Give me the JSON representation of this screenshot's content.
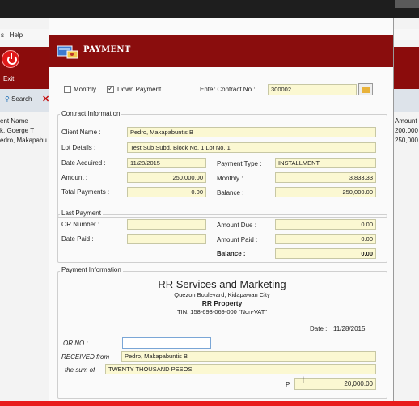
{
  "background_app": {
    "menu_help": "Help",
    "menu_prefix": "s",
    "exit_label": "Exit",
    "search_label": "Search",
    "left_table": {
      "header": "ent Name",
      "rows": [
        "k, Goerge T",
        "edro, Makapabu"
      ]
    },
    "right_table": {
      "header": "Amount",
      "rows": [
        "200,000",
        "250,000"
      ]
    }
  },
  "dialog": {
    "title": "PAYMENT",
    "top_options": {
      "monthly_label": "Monthly",
      "monthly_checked": false,
      "down_payment_label": "Down Payment",
      "down_payment_checked": true,
      "contract_label": "Enter Contract No :",
      "contract_value": "300002"
    },
    "contract_info": {
      "title": "Contract Information",
      "client_name_label": "Client Name :",
      "client_name": "Pedro, Makapabuntis B",
      "lot_details_label": "Lot Details :",
      "lot_details": "Test Sub Subd.  Block No. 1 Lot No. 1",
      "date_acquired_label": "Date Acquired :",
      "date_acquired": "11/28/2015",
      "payment_type_label": "Payment Type :",
      "payment_type": "INSTALLMENT",
      "amount_label": "Amount :",
      "amount": "250,000.00",
      "monthly_label": "Monthly :",
      "monthly": "3,833.33",
      "total_payments_label": "Total Payments :",
      "total_payments": "0.00",
      "balance_label": "Balance :",
      "balance": "250,000.00"
    },
    "last_payment": {
      "title": "Last Payment",
      "or_number_label": "OR Number :",
      "or_number": "",
      "date_paid_label": "Date Paid :",
      "date_paid": "",
      "amount_due_label": "Amount Due :",
      "amount_due": "0.00",
      "amount_paid_label": "Amount Paid :",
      "amount_paid": "0.00",
      "balance_label": "Balance :",
      "balance": "0.00"
    },
    "payment_info": {
      "title": "Payment Information",
      "company_name": "RR Services and Marketing",
      "address": "Quezon Boulevard, Kidapawan City",
      "property": "RR Property",
      "tin": "TIN: 158-693-069-000 \"Non-VAT\"",
      "date_label": "Date :",
      "date": "11/28/2015",
      "or_no_label": "OR NO :",
      "or_no": "",
      "received_from_label": "RECEIVED from",
      "received_from": "Pedro, Makapabuntis B",
      "sum_label": "the sum of",
      "sum_words": "TWENTY  THOUSAND  PESOS",
      "peso_label": "P",
      "amount": "20,000.00"
    }
  },
  "colors": {
    "header_red": "#8a0d0d",
    "field_yellow": "#fbf8d2",
    "bottom_bar": "#e81c1c"
  }
}
